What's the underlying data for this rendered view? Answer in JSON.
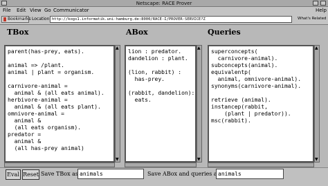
{
  "window": {
    "title": "Netscape: RACE Prover"
  },
  "menu": [
    "File",
    "Edit",
    "View",
    "Go",
    "Communicator"
  ],
  "help_label": "Help",
  "toolbar": {
    "bookmarks_label": "Bookmarks",
    "location_label": "Location:",
    "url": "http://kogs1.informatik.uni-hamburg.de:8000/RACE-I/PROVER-SERVICE?Z",
    "related_label": "What's Related"
  },
  "sections": {
    "tbox_title": "TBox",
    "abox_title": "ABox",
    "queries_title": "Queries"
  },
  "tbox_text": "parent(has-prey, eats).\n\nanimal => /plant.\nanimal | plant = organism.\n\ncarnivore-animal =\n  animal & (all eats animal).\nherbivore-animal =\n  animal & (all eats plant).\nomnivore-animal =\n  animal &\n  (all eats organism).\npredator =\n  animal &\n  (all has-prey animal)",
  "abox_text": "lion : predator.\ndandelion : plant.\n\n(lion, rabbit) :\n  has-prey.\n\n(rabbit, dandelion):\n  eats.",
  "queries_text": "superconcepts(\n  carnivore-animal).\nsubconcepts(animal).\nequivalentp(\n  animal, omnivore-animal).\nsynonyms(carnivore-animal).\n\nretrieve (animal).\ninstancep(rabbit,\n    (plant | predator)).\nmsc(rabbit).",
  "buttons": {
    "eval_label": "Eval",
    "reset_label": "Reset"
  },
  "save_tbox": {
    "label": "Save TBox as:",
    "value": "animals"
  },
  "save_abox": {
    "label": "Save ABox and queries as:",
    "value": "animals"
  }
}
